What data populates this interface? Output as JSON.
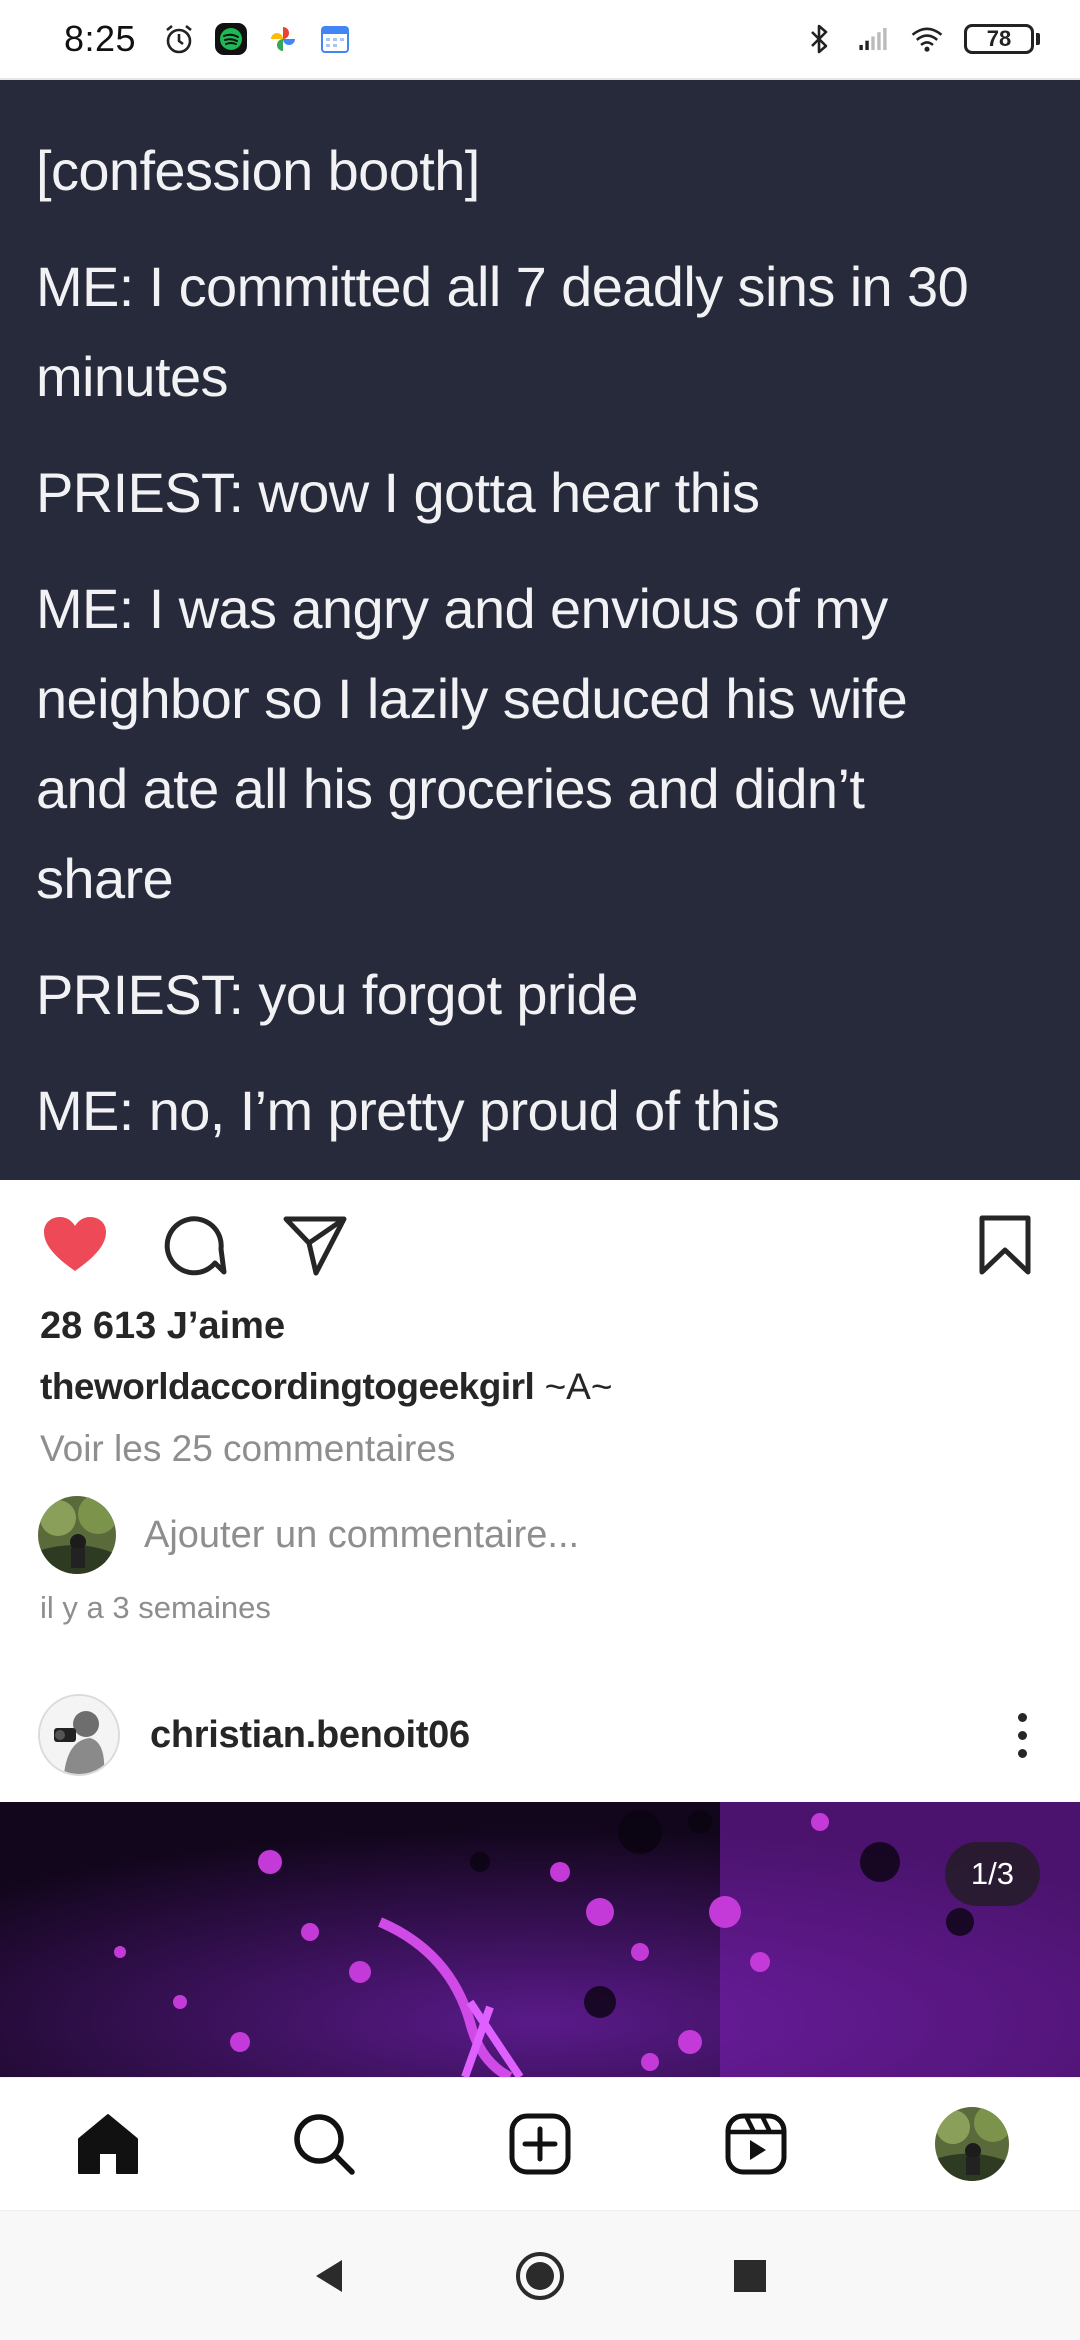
{
  "status_bar": {
    "time": "8:25",
    "battery": "78",
    "left_icons": [
      "alarm-icon",
      "spotify-icon",
      "google-photos-icon",
      "calendar-icon"
    ],
    "right_icons": [
      "bluetooth-icon",
      "signal-icon",
      "wifi-icon",
      "battery-icon"
    ]
  },
  "post": {
    "lines": [
      "[confession booth]",
      "ME: I committed all 7 deadly sins in 30",
      "minutes",
      "PRIEST: wow I gotta hear this",
      "ME: I was angry and envious of my",
      "neighbor so I lazily seduced his wife",
      "and ate all his groceries and didn’t",
      "share",
      "PRIEST: you forgot pride",
      "ME: no, I’m pretty proud of this"
    ],
    "likes": "28 613 J’aime",
    "caption_username": "theworldaccordingtogeekgirl",
    "caption_text": " ~A~",
    "view_comments": "Voir les 25 commentaires",
    "add_comment_placeholder": "Ajouter un commentaire...",
    "timestamp": "il y a 3 semaines",
    "liked": true,
    "like_color": "#ed4956"
  },
  "next_post": {
    "username": "christian.benoit06",
    "page_indicator": "1/3"
  },
  "bottom_nav": {
    "items": [
      "home-icon",
      "search-icon",
      "create-icon",
      "reels-icon",
      "profile-avatar"
    ]
  },
  "colors": {
    "post_background": "#262a3a",
    "post_text": "#f2f2f5",
    "secondary_text": "#8e8e8e"
  }
}
